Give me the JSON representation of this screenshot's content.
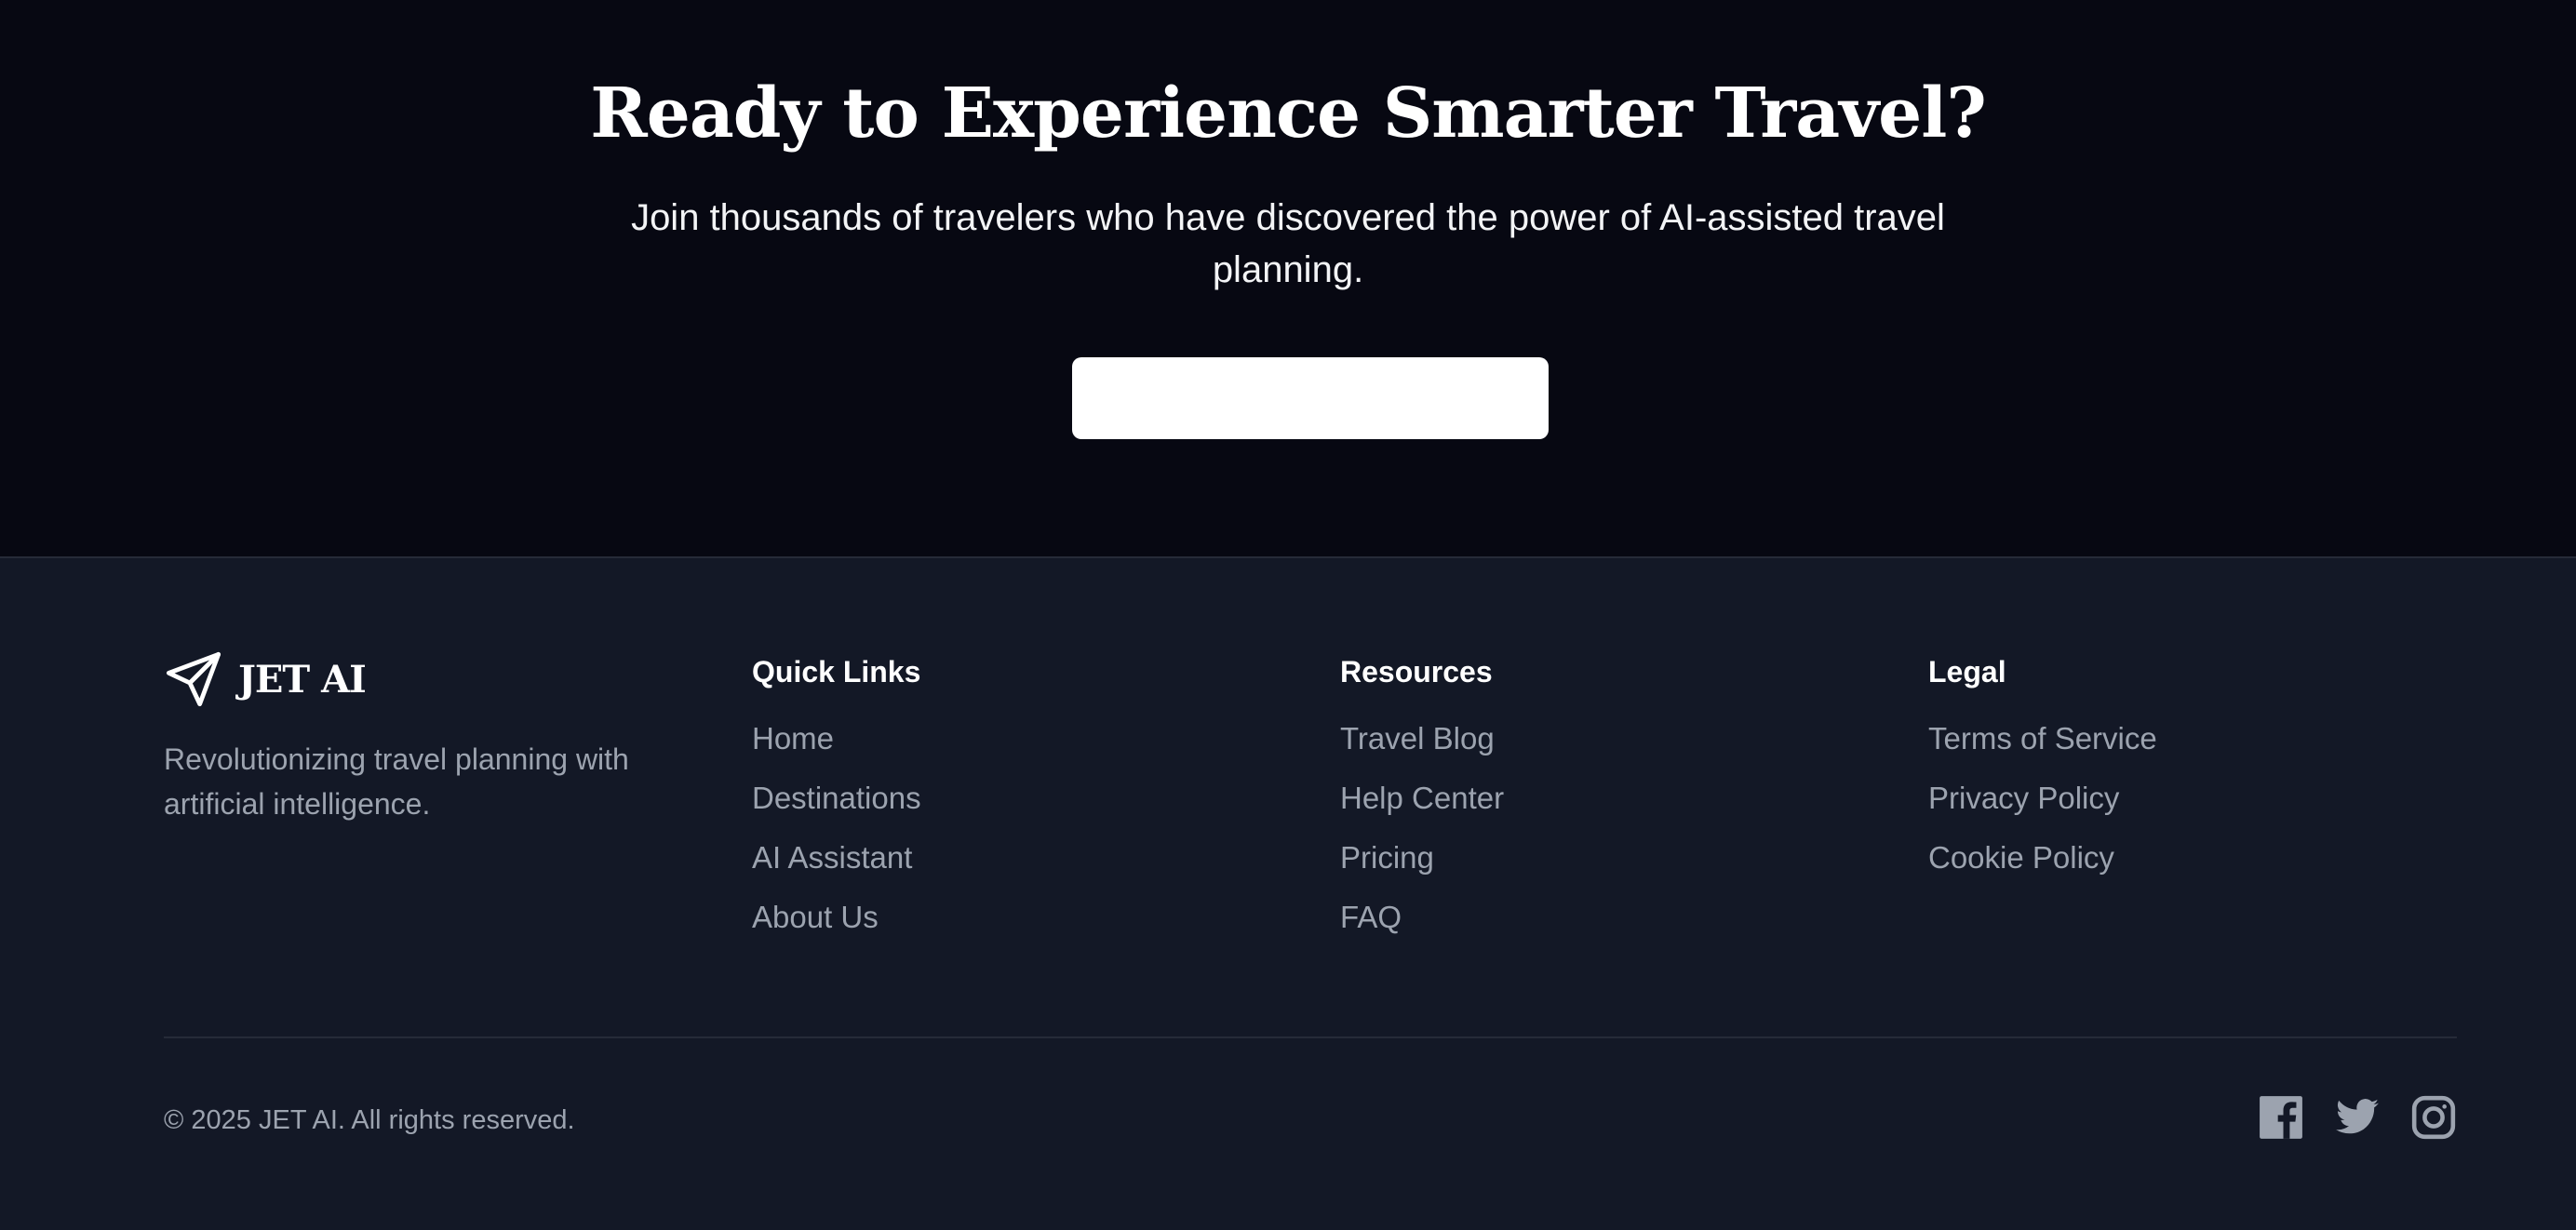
{
  "cta": {
    "title": "Ready to Experience Smarter Travel?",
    "subtitle": "Join thousands of travelers who have discovered the power of AI-assisted travel planning.",
    "button_label": ""
  },
  "footer": {
    "brand": {
      "icon": "paper-plane-icon",
      "name": "JET AI",
      "tagline": "Revolutionizing travel planning with artificial intelligence."
    },
    "quick_links": {
      "title": "Quick Links",
      "items": [
        "Home",
        "Destinations",
        "AI Assistant",
        "About Us"
      ]
    },
    "resources": {
      "title": "Resources",
      "items": [
        "Travel Blog",
        "Help Center",
        "Pricing",
        "FAQ"
      ]
    },
    "legal": {
      "title": "Legal",
      "items": [
        "Terms of Service",
        "Privacy Policy",
        "Cookie Policy"
      ]
    },
    "copyright": "© 2025 JET AI. All rights reserved.",
    "social": [
      "facebook-icon",
      "twitter-icon",
      "instagram-icon"
    ]
  },
  "colors": {
    "cta_background": "#070812",
    "footer_background": "#131826",
    "muted_text": "#9ca3af",
    "divider": "#262b38",
    "button_background": "#ffffff"
  }
}
